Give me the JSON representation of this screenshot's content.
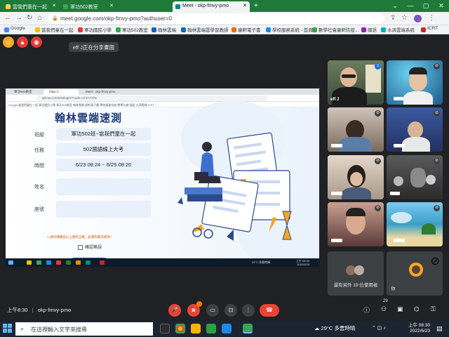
{
  "browser": {
    "tabs": [
      {
        "label": "雲我們童在一起",
        "color": "#ffd54f"
      },
      {
        "label": "軍功502教室",
        "color": "#34a853"
      },
      {
        "label": "Meet - okp-fmvy-pmo",
        "color": "#00897b"
      }
    ],
    "new_tab": "+",
    "window_controls": [
      "⌄",
      "—",
      "▢",
      "✕"
    ],
    "url": "meet.google.com/okp-fmvy-pmo?authuser=0",
    "bookmarks": [
      {
        "label": "Google",
        "color": "#4285f4"
      },
      {
        "label": "當我們童在一起",
        "color": "#fbbc05"
      },
      {
        "label": "軍功國民小學",
        "color": "#e53935"
      },
      {
        "label": "軍功502教室",
        "color": "#34a853"
      },
      {
        "label": "翰林雲端",
        "color": "#1565c0"
      },
      {
        "label": "翰林雲端雲學習教師",
        "color": "#1565c0"
      },
      {
        "label": "康軒電子書",
        "color": "#ef6c00"
      },
      {
        "label": "學校服務系統 - 首頁",
        "color": "#1e88e5"
      },
      {
        "label": "數學社會康軒防疫...",
        "color": "#43a047"
      },
      {
        "label": "國語",
        "color": "#8e24aa"
      },
      {
        "label": "水滴雲端系統",
        "color": "#00acc1"
      },
      {
        "label": "ICRT",
        "color": "#c62828"
      }
    ]
  },
  "meet": {
    "presenting_chip": "eff J正在分享畫面",
    "meeting_time": "上午8:30",
    "meeting_code": "okp-fmvy-pmo",
    "participant_count": "29",
    "others_label": "還有另外 19 位使用者",
    "you_label": "你",
    "speaker_name": "eff J"
  },
  "shared": {
    "tabs": [
      "軍功502教室",
      "https://...",
      "Meet - okp-fmvy-pmo"
    ],
    "url": "qbt.tw.com/test/login/?code=1T4A7276",
    "bookmarks": "Google  當我們童在一起  軍功國民小學  軍功502教室  翰林雲端  康軒電子書  學校服務系統  數學社會  國語  水滴雲端  ICRT",
    "quiz_title": "翰林雲端速測",
    "fields": {
      "class_label": "班級",
      "class_value": "軍功502班~當我們童在一起",
      "task_label": "任務",
      "task_value": "502國語線上大考",
      "time_label": "時間",
      "time_value": "6/23 08:24 ~ 6/25 08:20",
      "name_label": "姓名",
      "seat_label": "座號"
    },
    "warning": "請仔細確認以上資料正確，此資料無法修改！",
    "confirm_label": "確認無誤",
    "start_button": "開始",
    "weather": "29°C 多雲時晴",
    "clock_time": "上午 08:30",
    "clock_date": "2022/6/23"
  },
  "taskbar": {
    "search_placeholder": "在這裡輸入文字來搜尋",
    "weather": "29°C 多雲時晴",
    "time": "上午 08:30",
    "date": "2022/6/23"
  }
}
